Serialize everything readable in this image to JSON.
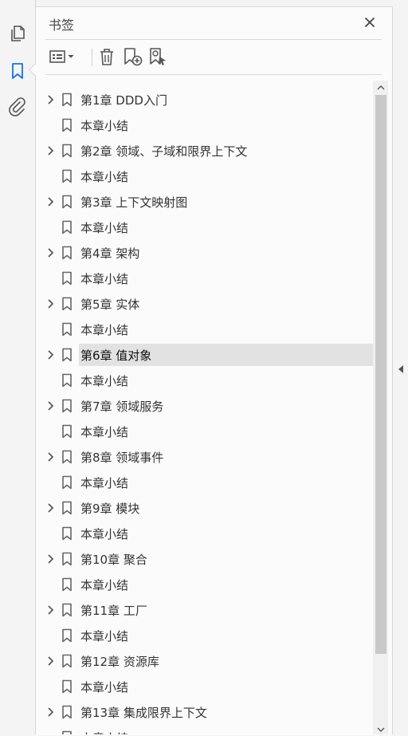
{
  "rail": {
    "items": [
      {
        "name": "pages-icon"
      },
      {
        "name": "bookmarks-icon"
      },
      {
        "name": "attachments-icon"
      }
    ],
    "active_color": "#1473e6"
  },
  "panel": {
    "title": "书签",
    "toolbar": {
      "options_icon": "options-list-icon",
      "delete_icon": "trash-icon",
      "new_bookmark_icon": "new-bookmark-icon",
      "find_bookmark_icon": "find-current-bookmark-icon"
    }
  },
  "bookmarks": [
    {
      "label": "第1章  DDD入门",
      "expandable": true
    },
    {
      "label": "本章小结",
      "expandable": false
    },
    {
      "label": "第2章  领域、子域和限界上下文",
      "expandable": true
    },
    {
      "label": "本章小结",
      "expandable": false
    },
    {
      "label": "第3章  上下文映射图",
      "expandable": true
    },
    {
      "label": "本章小结",
      "expandable": false
    },
    {
      "label": "第4章  架构",
      "expandable": true
    },
    {
      "label": "本章小结",
      "expandable": false
    },
    {
      "label": "第5章  实体",
      "expandable": true
    },
    {
      "label": "本章小结",
      "expandable": false
    },
    {
      "label": "第6章  值对象",
      "expandable": true,
      "selected": true
    },
    {
      "label": "本章小结",
      "expandable": false
    },
    {
      "label": "第7章  领域服务",
      "expandable": true
    },
    {
      "label": "本章小结",
      "expandable": false
    },
    {
      "label": "第8章  领域事件",
      "expandable": true
    },
    {
      "label": "本章小结",
      "expandable": false
    },
    {
      "label": "第9章  模块",
      "expandable": true
    },
    {
      "label": "本章小结",
      "expandable": false
    },
    {
      "label": "第10章  聚合",
      "expandable": true
    },
    {
      "label": "本章小结",
      "expandable": false
    },
    {
      "label": "第11章  工厂",
      "expandable": true
    },
    {
      "label": "本章小结",
      "expandable": false
    },
    {
      "label": "第12章  资源库",
      "expandable": true
    },
    {
      "label": "本章小结",
      "expandable": false
    },
    {
      "label": "第13章  集成限界上下文",
      "expandable": true
    },
    {
      "label": "本章小结",
      "expandable": false
    }
  ]
}
